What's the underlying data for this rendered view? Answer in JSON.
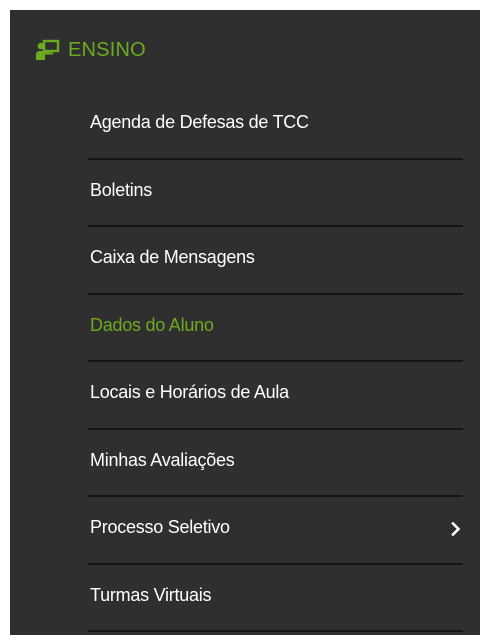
{
  "menu": {
    "section_title": "ENSINO",
    "section_icon": "chalkboard-teacher-icon",
    "accent_color": "#6cab1f",
    "items": [
      {
        "label": "Agenda de Defesas de TCC",
        "active": false
      },
      {
        "label": "Boletins",
        "active": false
      },
      {
        "label": "Caixa de Mensagens",
        "active": false
      },
      {
        "label": "Dados do Aluno",
        "active": true
      },
      {
        "label": "Locais e Horários de Aula",
        "active": false
      },
      {
        "label": "Minhas Avaliações",
        "active": false
      },
      {
        "label": "Processo Seletivo",
        "active": false,
        "has_submenu": true,
        "submenu_icon": "chevron-right-icon"
      },
      {
        "label": "Turmas Virtuais",
        "active": false
      }
    ]
  }
}
